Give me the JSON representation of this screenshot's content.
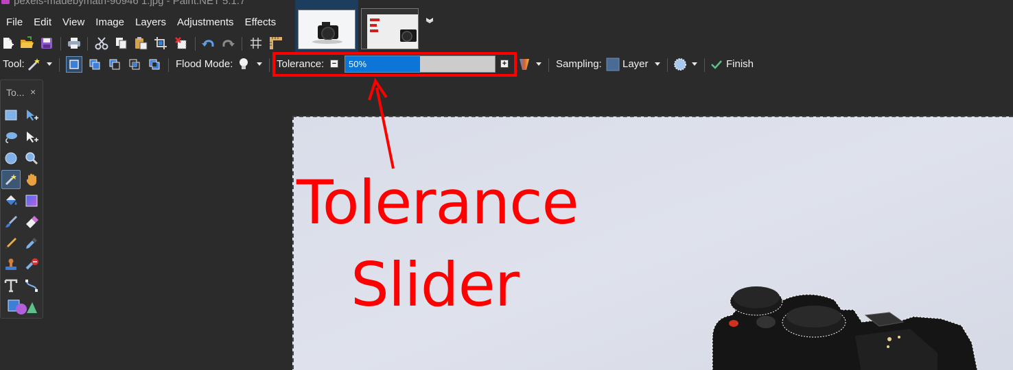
{
  "window": {
    "title": "pexels-madebymath-90946 1.jpg - Paint.NET 5.1.7"
  },
  "menu": {
    "items": [
      "File",
      "Edit",
      "View",
      "Image",
      "Layers",
      "Adjustments",
      "Effects"
    ]
  },
  "toolbar": {
    "icons": [
      "new-file-icon",
      "open-folder-icon",
      "save-icon",
      "print-icon",
      "cut-icon",
      "copy-icon",
      "paste-icon",
      "crop-to-selection-icon",
      "deselect-icon",
      "undo-icon",
      "redo-icon",
      "grid-icon",
      "ruler-icon"
    ]
  },
  "options": {
    "tool_label": "Tool:",
    "flood_mode_label": "Flood Mode:",
    "tolerance_label": "Tolerance:",
    "tolerance_value": "50%",
    "tolerance_fraction": 0.5,
    "sampling_label": "Sampling:",
    "sampling_value": "Layer",
    "finish_label": "Finish"
  },
  "tools_window": {
    "title": "To...",
    "close": "×"
  },
  "annotation": {
    "line1": "Tolerance",
    "line2": "Slider"
  },
  "colors": {
    "accent": "#0c75d8",
    "annotation": "#ff0000",
    "background": "#2b2b2b"
  }
}
